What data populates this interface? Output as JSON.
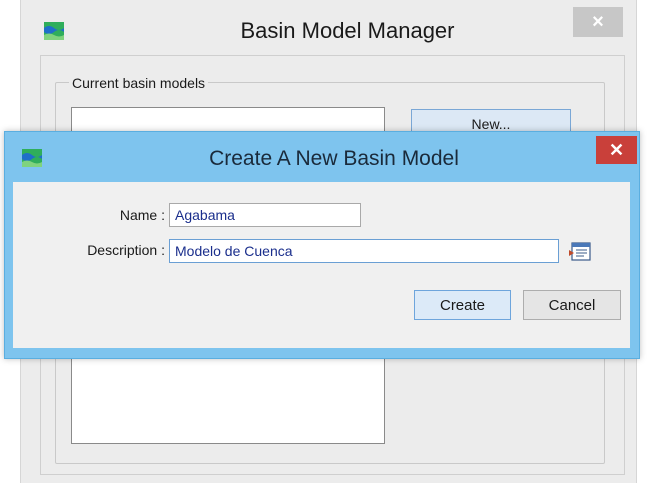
{
  "background_window": {
    "title": "Basin Model Manager",
    "close_label": "×",
    "group_label": "Current basin models",
    "new_button_label": "New..."
  },
  "dialog": {
    "title": "Create A New Basin Model",
    "close_label": "✕",
    "name_label": "Name :",
    "name_value": "Agabama",
    "description_label": "Description :",
    "description_value": "Modelo de Cuenca",
    "create_label": "Create",
    "cancel_label": "Cancel"
  },
  "icons": {
    "app_icon": "basin-model-icon",
    "browse_icon": "description-editor-icon"
  },
  "colors": {
    "dialog_titlebar": "#7ec4ee",
    "dialog_close": "#c9403a",
    "field_text": "#1a2e8c"
  }
}
